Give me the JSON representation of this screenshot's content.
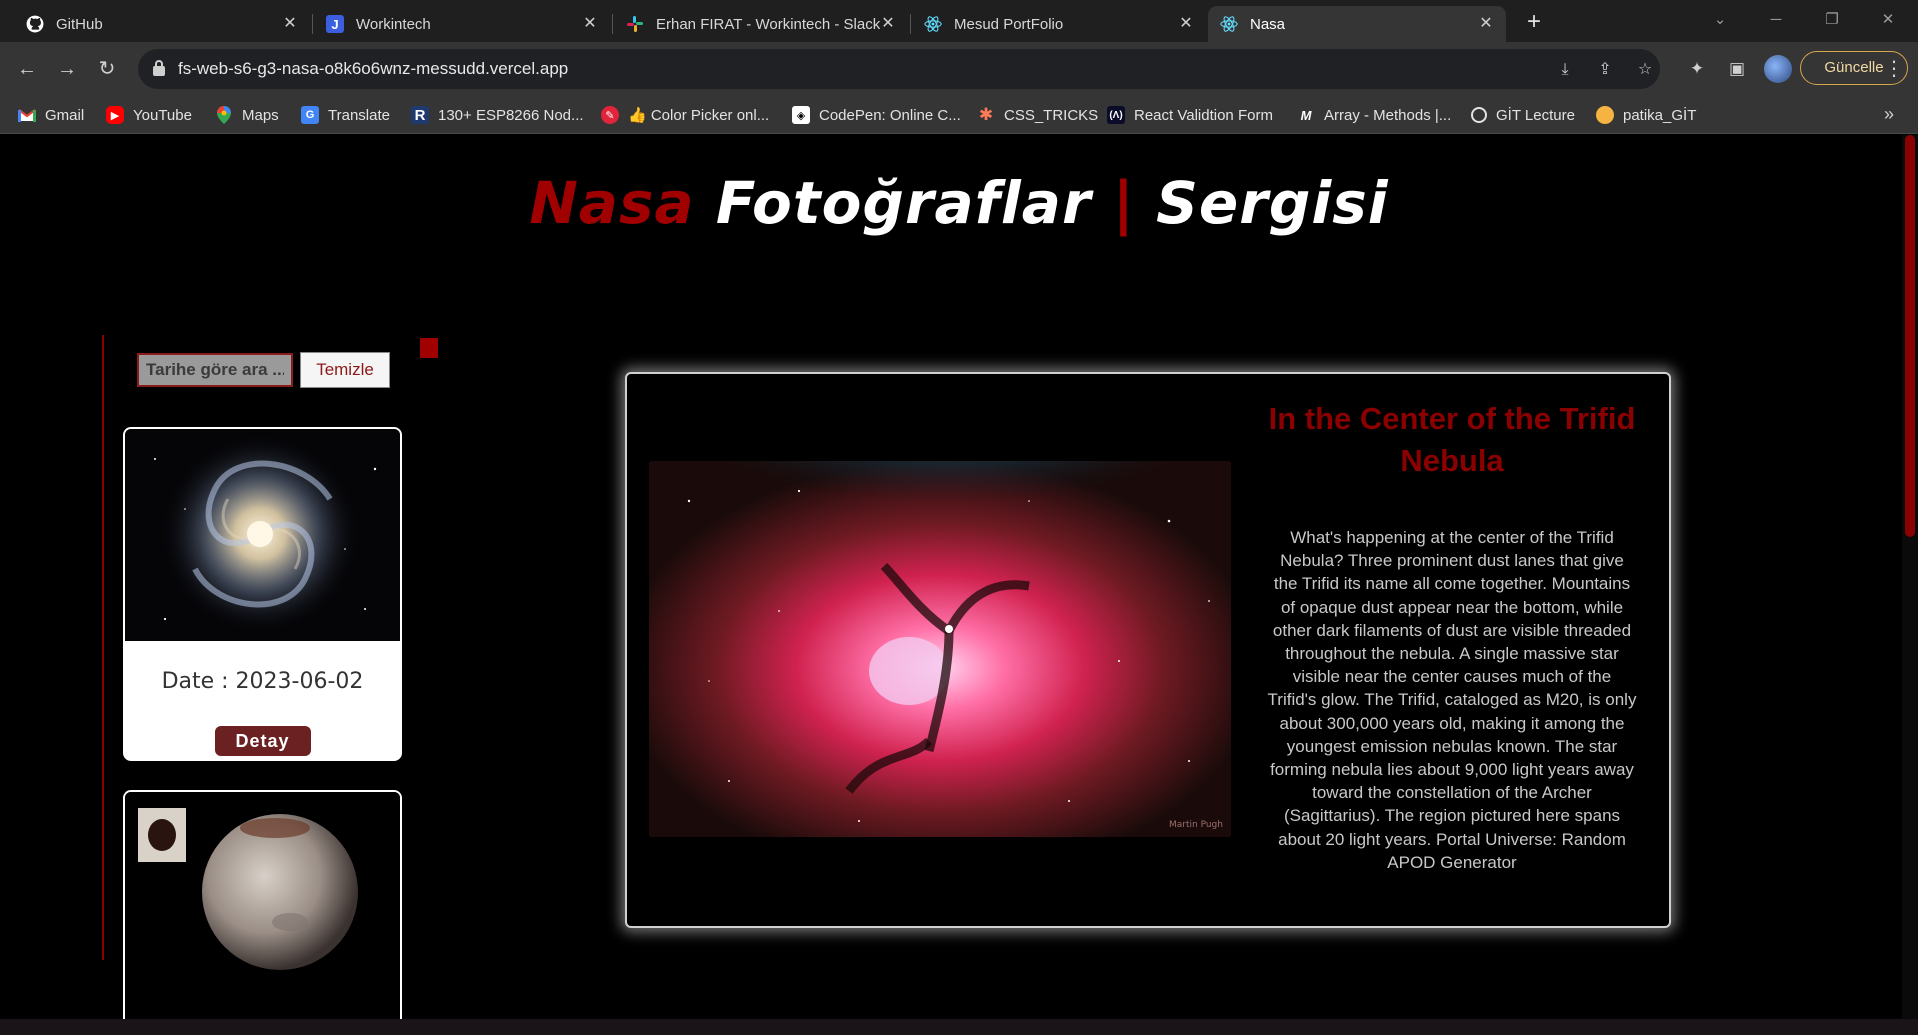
{
  "browser": {
    "tabs": [
      {
        "label": "GitHub",
        "icon": "github-icon"
      },
      {
        "label": "Workintech",
        "icon": "workintech-icon"
      },
      {
        "label": "Erhan FIRAT - Workintech - Slack",
        "icon": "slack-icon"
      },
      {
        "label": "Mesud PortFolio",
        "icon": "react-icon"
      },
      {
        "label": "Nasa",
        "icon": "react-icon",
        "active": true
      }
    ],
    "url": "fs-web-s6-g3-nasa-o8k6o6wnz-messudd.vercel.app",
    "update_label": "Güncelle",
    "bookmarks": [
      {
        "label": "Gmail",
        "icon": "gmail-icon"
      },
      {
        "label": "YouTube",
        "icon": "youtube-icon"
      },
      {
        "label": "Maps",
        "icon": "maps-icon"
      },
      {
        "label": "Translate",
        "icon": "translate-icon"
      },
      {
        "label": "130+ ESP8266 Nod...",
        "icon": "r-icon"
      },
      {
        "label": "👍 Color Picker onl...",
        "icon": "color-picker-icon"
      },
      {
        "label": "CodePen: Online C...",
        "icon": "codepen-icon"
      },
      {
        "label": "CSS_TRICKS",
        "icon": "css-tricks-icon"
      },
      {
        "label": "React Validtion Form",
        "icon": "react-validation-icon"
      },
      {
        "label": "Array - Methods |...",
        "icon": "array-icon"
      },
      {
        "label": "GİT Lecture",
        "icon": "globe-icon"
      },
      {
        "label": "patika_GİT",
        "icon": "patika-icon"
      }
    ]
  },
  "page": {
    "title_part1": "Nasa",
    "title_part2": "Fotoğraflar",
    "title_sep": "|",
    "title_part3": "Sergisi",
    "search_placeholder": "Tarihe göre ara ...",
    "clear_label": "Temizle",
    "cards": [
      {
        "date": "Date : 2023-06-02",
        "button": "Detay",
        "image": "spiral-galaxy"
      },
      {
        "image": "charon-moon"
      }
    ],
    "feature": {
      "title": "In the Center of the Trifid Nebula",
      "image": "trifid-nebula",
      "watermark": "Martin Pugh",
      "explanation": "What's happening at the center of the Trifid Nebula? Three prominent dust lanes that give the Trifid its name all come together. Mountains of opaque dust appear near the bottom, while other dark filaments of dust are visible threaded throughout the nebula. A single massive star visible near the center causes much of the Trifid's glow. The Trifid, cataloged as M20, is only about 300,000 years old, making it among the youngest emission nebulas known. The star forming nebula lies about 9,000 light years away toward the constellation of the Archer (Sagittarius). The region pictured here spans about 20 light years. Portal Universe: Random APOD Generator"
    }
  },
  "colors": {
    "accent_red": "#a00000",
    "button_brown": "#6b2121",
    "update_gold": "#d5a74e"
  }
}
